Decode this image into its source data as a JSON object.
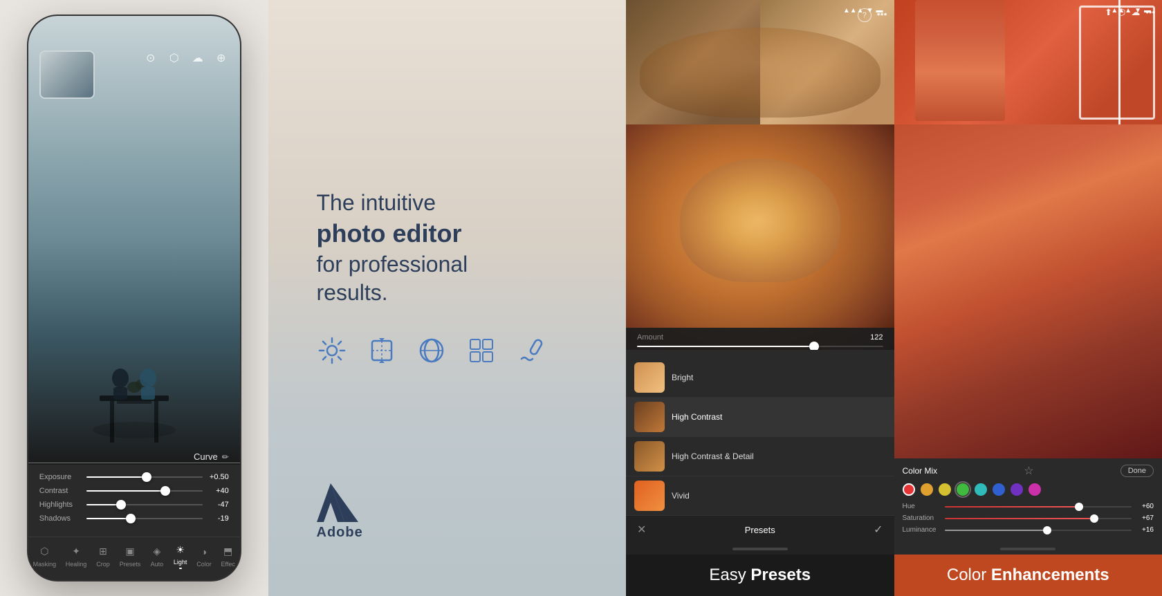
{
  "panels": {
    "panel1": {
      "sliders": [
        {
          "label": "Exposure",
          "value": "+0.50",
          "fill_pct": 52
        },
        {
          "label": "Contrast",
          "value": "+40",
          "fill_pct": 68
        },
        {
          "label": "Highlights",
          "value": "-47",
          "fill_pct": 30
        },
        {
          "label": "Shadows",
          "value": "-19",
          "fill_pct": 38
        }
      ],
      "curve_label": "Curve",
      "nav_items": [
        {
          "label": "Masking",
          "active": false
        },
        {
          "label": "Healing",
          "active": false
        },
        {
          "label": "Crop",
          "active": false
        },
        {
          "label": "Presets",
          "active": false
        },
        {
          "label": "Auto",
          "active": false
        },
        {
          "label": "Light",
          "active": true
        },
        {
          "label": "Color",
          "active": false
        },
        {
          "label": "Effec",
          "active": false
        }
      ]
    },
    "panel2": {
      "tagline_normal1": "The intuitive",
      "tagline_bold": "photo editor",
      "tagline_normal2": "for professional",
      "tagline_normal3": "results.",
      "adobe_label": "Adobe"
    },
    "panel3": {
      "amount_label": "Amount",
      "amount_value": "122",
      "amount_fill_pct": 72,
      "presets": [
        {
          "name": "Bright",
          "active": false
        },
        {
          "name": "High Contrast",
          "active": true
        },
        {
          "name": "High Contrast & Detail",
          "active": false
        },
        {
          "name": "Vivid",
          "active": false
        }
      ],
      "bottom_center": "Presets",
      "caption_light": "Easy ",
      "caption_bold": "Presets"
    },
    "panel4": {
      "header_label": "Color Mix",
      "done_label": "Done",
      "color_dots": [
        {
          "color": "#e63333",
          "active": true
        },
        {
          "color": "#e0a030",
          "active": false
        },
        {
          "color": "#d4c030",
          "active": false
        },
        {
          "color": "#40bb40",
          "active": false
        },
        {
          "color": "#30bbbb",
          "active": false
        },
        {
          "color": "#3060d0",
          "active": false
        },
        {
          "color": "#7030c0",
          "active": false
        },
        {
          "color": "#cc30aa",
          "active": false
        }
      ],
      "adjustments": [
        {
          "label": "Hue",
          "value": "+60",
          "fill_pct": 72,
          "color": "red"
        },
        {
          "label": "Saturation",
          "value": "+67",
          "fill_pct": 80,
          "color": "red"
        },
        {
          "label": "Luminance",
          "value": "+16",
          "fill_pct": 55,
          "color": "white"
        }
      ],
      "caption_light": "Color ",
      "caption_bold": "Enhancements"
    }
  }
}
